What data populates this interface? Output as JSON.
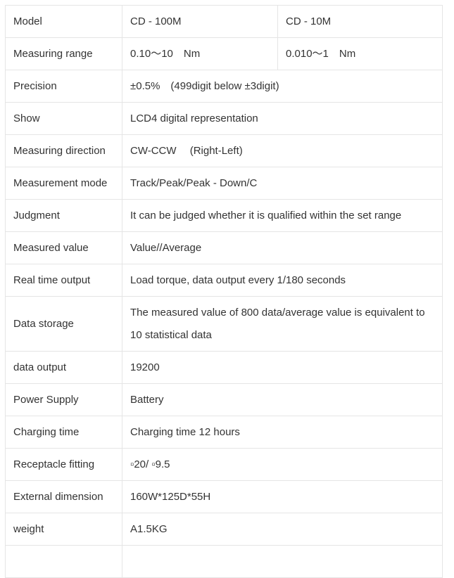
{
  "spec_table": {
    "header": {
      "label": "Model",
      "models": [
        "CD - 100M",
        "CD - 10M"
      ]
    },
    "measuring_range": {
      "label": "Measuring range",
      "values": [
        "0.10～10　Nm",
        "0.010～1　Nm"
      ]
    },
    "rows": [
      {
        "label": "Precision",
        "value": "±0.5%　(499digit below ±3digit)"
      },
      {
        "label": "Show",
        "value": "LCD4 digital representation"
      },
      {
        "label": "Measuring direction",
        "value": "CW-CCW　 (Right-Left)"
      },
      {
        "label": "Measurement mode",
        "value": "Track/Peak/Peak - Down/C"
      },
      {
        "label": "Judgment",
        "value": "It can be judged whether it is qualified within the set range"
      },
      {
        "label": "Measured value",
        "value": "Value//Average"
      },
      {
        "label": "Real time output",
        "value": "Load torque, data output every 1/180 seconds"
      },
      {
        "label": "Data storage",
        "value": "The measured value of 800 data/average value is equivalent to 10 statistical data"
      },
      {
        "label": "data output",
        "value": "19200"
      },
      {
        "label": "Power Supply",
        "value": "Battery"
      },
      {
        "label": "Charging time",
        "value": "Charging time 12 hours"
      },
      {
        "label": "Receptacle fitting",
        "value": "▫20/ ▫9.5"
      },
      {
        "label": "External dimension",
        "value": "160W*125D*55H"
      },
      {
        "label": "weight",
        "value": "A1.5KG"
      }
    ]
  }
}
